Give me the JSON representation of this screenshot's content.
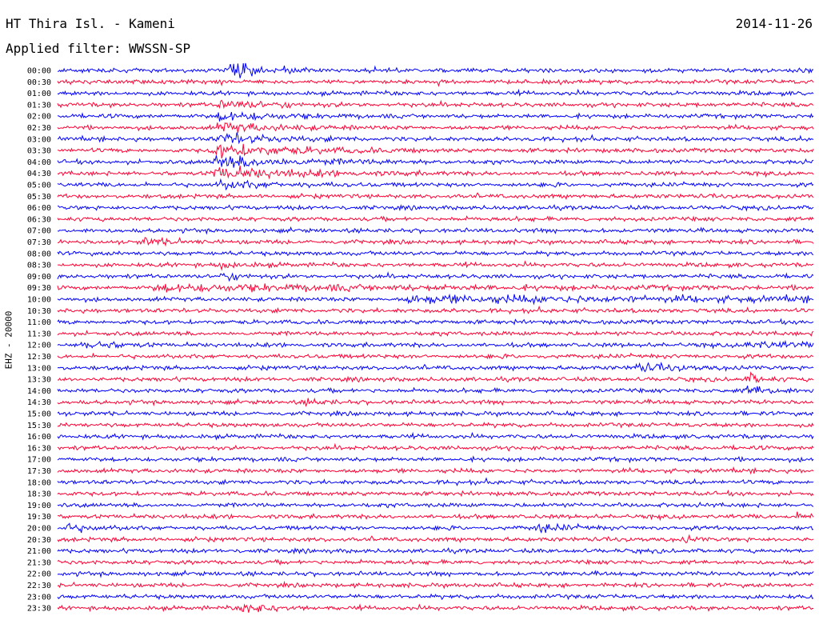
{
  "header": {
    "station": "HT Thira Isl. - Kameni",
    "date": "2014-11-26",
    "filter": "Applied filter: WWSSN-SP"
  },
  "chart_data": {
    "type": "line",
    "title": "HT Thira Isl. - Kameni",
    "ylabel": "EHZ - 20000",
    "tick_labels": [
      "00:00",
      "00:30",
      "01:00",
      "01:30",
      "02:00",
      "02:30",
      "03:00",
      "03:30",
      "04:00",
      "04:30",
      "05:00",
      "05:30",
      "06:00",
      "06:30",
      "07:00",
      "07:30",
      "08:00",
      "08:30",
      "09:00",
      "09:30",
      "10:00",
      "10:30",
      "11:00",
      "11:30",
      "12:00",
      "12:30",
      "13:00",
      "13:30",
      "14:00",
      "14:30",
      "15:00",
      "15:30",
      "16:00",
      "16:30",
      "17:00",
      "17:30",
      "18:00",
      "18:30",
      "19:00",
      "19:30",
      "20:00",
      "20:30",
      "21:00",
      "21:30",
      "22:00",
      "22:30",
      "23:00",
      "23:30"
    ],
    "trace_colors": [
      "#0000ff",
      "#ff0033"
    ],
    "minutes_per_trace": 30,
    "events": [
      {
        "trace": 0,
        "minute": 7,
        "amplitude": 3.5,
        "duration": 1.2
      },
      {
        "trace": 3,
        "minute": 6.5,
        "amplitude": 1.8,
        "duration": 2
      },
      {
        "trace": 4,
        "minute": 6.5,
        "amplitude": 2.0,
        "duration": 2
      },
      {
        "trace": 5,
        "minute": 6.5,
        "amplitude": 2.2,
        "duration": 2
      },
      {
        "trace": 6,
        "minute": 6.5,
        "amplitude": 2.4,
        "duration": 2
      },
      {
        "trace": 7,
        "minute": 6.3,
        "amplitude": 2.8,
        "duration": 3
      },
      {
        "trace": 8,
        "minute": 6.3,
        "amplitude": 2.8,
        "duration": 3
      },
      {
        "trace": 9,
        "minute": 6.3,
        "amplitude": 2.6,
        "duration": 3
      },
      {
        "trace": 10,
        "minute": 6.5,
        "amplitude": 1.6,
        "duration": 2
      },
      {
        "trace": 15,
        "minute": 3.5,
        "amplitude": 1.4,
        "duration": 1.2
      },
      {
        "trace": 17,
        "minute": 6.5,
        "amplitude": 1.2,
        "duration": 1
      },
      {
        "trace": 18,
        "minute": 6.5,
        "amplitude": 1.4,
        "duration": 1
      },
      {
        "trace": 19,
        "minute": 4,
        "amplitude": 1.3,
        "duration": 12
      },
      {
        "trace": 20,
        "minute": 14,
        "amplitude": 1.4,
        "duration": 15
      },
      {
        "trace": 24,
        "minute": 1.2,
        "amplitude": 2.2,
        "duration": 1
      },
      {
        "trace": 24,
        "minute": 27.5,
        "amplitude": 1.8,
        "duration": 1.5
      },
      {
        "trace": 26,
        "minute": 23,
        "amplitude": 1.6,
        "duration": 1.5
      },
      {
        "trace": 27,
        "minute": 27.5,
        "amplitude": 2.2,
        "duration": 0.5
      },
      {
        "trace": 28,
        "minute": 27.5,
        "amplitude": 2.2,
        "duration": 1
      },
      {
        "trace": 29,
        "minute": 10,
        "amplitude": 1.2,
        "duration": 0.6
      },
      {
        "trace": 39,
        "minute": 29.5,
        "amplitude": 1.6,
        "duration": 0.5
      },
      {
        "trace": 40,
        "minute": 0,
        "amplitude": 2.2,
        "duration": 1
      },
      {
        "trace": 40,
        "minute": 19,
        "amplitude": 1.8,
        "duration": 1
      },
      {
        "trace": 41,
        "minute": 25,
        "amplitude": 1.4,
        "duration": 0.3
      },
      {
        "trace": 47,
        "minute": 7.5,
        "amplitude": 2.4,
        "duration": 1
      }
    ]
  }
}
